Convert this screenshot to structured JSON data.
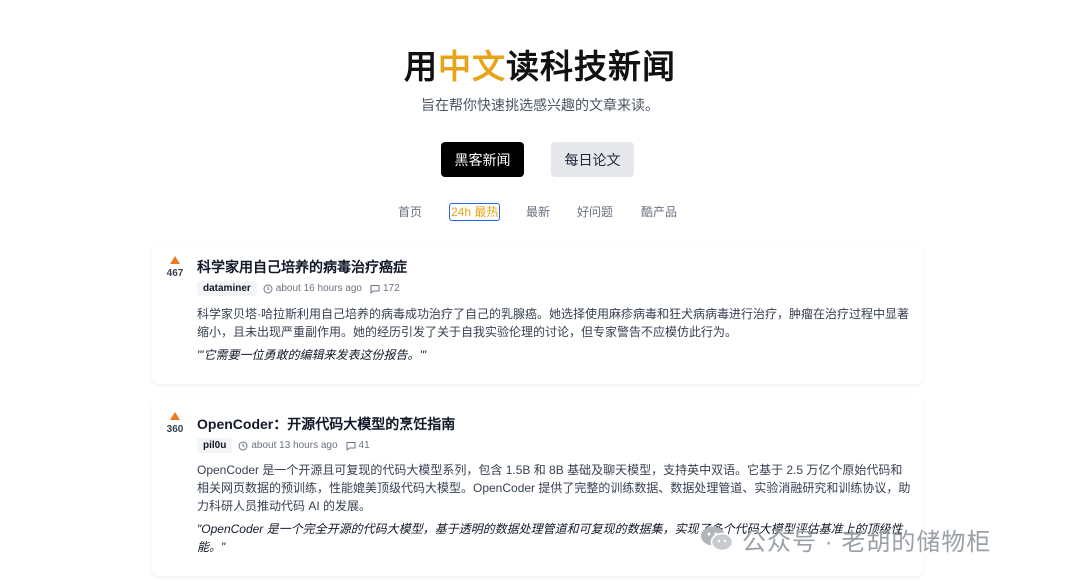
{
  "hero": {
    "title_prefix": "用",
    "title_accent": "中文",
    "title_suffix": "读科技新闻",
    "subtitle": "旨在帮你快速挑选感兴趣的文章来读。"
  },
  "buttons": {
    "primary": "黑客新闻",
    "secondary": "每日论文"
  },
  "subnav": [
    "首页",
    "24h 最热",
    "最新",
    "好问题",
    "酷产品"
  ],
  "subnav_active_index": 1,
  "colors": {
    "accent": "#e8a317",
    "upvote": "#ea7a20",
    "active_border": "#2563eb"
  },
  "posts": [
    {
      "score": "467",
      "title": "科学家用自己培养的病毒治疗癌症",
      "author": "dataminer",
      "time": "about 16 hours ago",
      "comments": "172",
      "summary": "科学家贝塔·哈拉斯利用自己培养的病毒成功治疗了自己的乳腺癌。她选择使用麻疹病毒和狂犬病病毒进行治疗，肿瘤在治疗过程中显著缩小，且未出现严重副作用。她的经历引发了关于自我实验伦理的讨论，但专家警告不应模仿此行为。",
      "quote": "\"'它需要一位勇敢的编辑来发表这份报告。'\""
    },
    {
      "score": "360",
      "title": "OpenCoder：开源代码大模型的烹饪指南",
      "author": "pil0u",
      "time": "about 13 hours ago",
      "comments": "41",
      "summary": "OpenCoder 是一个开源且可复现的代码大模型系列，包含 1.5B 和 8B 基础及聊天模型，支持英中双语。它基于 2.5 万亿个原始代码和相关网页数据的预训练，性能媲美顶级代码大模型。OpenCoder 提供了完整的训练数据、数据处理管道、实验消融研究和训练协议，助力科研人员推动代码 AI 的发展。",
      "quote": "\"OpenCoder 是一个完全开源的代码大模型，基于透明的数据处理管道和可复现的数据集，实现了多个代码大模型评估基准上的顶级性能。\""
    }
  ],
  "watermark": "公众号 · 老胡的储物柜"
}
